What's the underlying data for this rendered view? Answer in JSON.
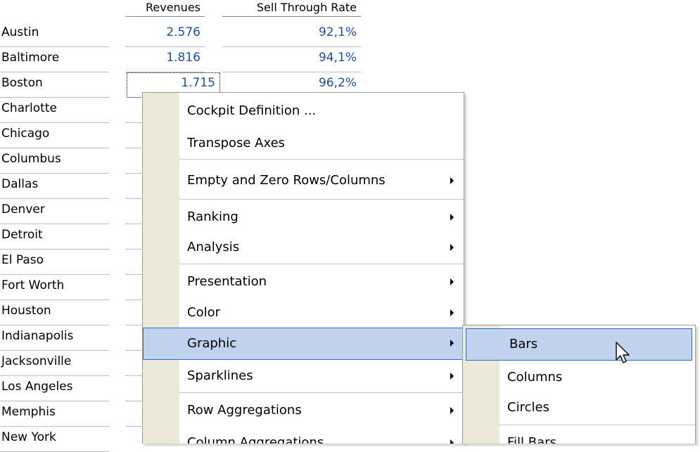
{
  "grid": {
    "headers": [
      "Revenues",
      "Sell Through Rate"
    ],
    "rows": [
      {
        "city": "Austin",
        "revenues": "2.576",
        "sell_through": "92,1%"
      },
      {
        "city": "Baltimore",
        "revenues": "1.816",
        "sell_through": "94,1%"
      },
      {
        "city": "Boston",
        "revenues": "1.715",
        "sell_through": "96,2%"
      },
      {
        "city": "Charlotte",
        "revenues": "",
        "sell_through": ""
      },
      {
        "city": "Chicago",
        "revenues": "",
        "sell_through": ""
      },
      {
        "city": "Columbus",
        "revenues": "",
        "sell_through": ""
      },
      {
        "city": "Dallas",
        "revenues": "",
        "sell_through": ""
      },
      {
        "city": "Denver",
        "revenues": "",
        "sell_through": ""
      },
      {
        "city": "Detroit",
        "revenues": "",
        "sell_through": ""
      },
      {
        "city": "El Paso",
        "revenues": "",
        "sell_through": ""
      },
      {
        "city": "Fort Worth",
        "revenues": "",
        "sell_through": ""
      },
      {
        "city": "Houston",
        "revenues": "",
        "sell_through": ""
      },
      {
        "city": "Indianapolis",
        "revenues": "",
        "sell_through": ""
      },
      {
        "city": "Jacksonville",
        "revenues": "",
        "sell_through": ""
      },
      {
        "city": "Los Angeles",
        "revenues": "",
        "sell_through": ""
      },
      {
        "city": "Memphis",
        "revenues": "",
        "sell_through": ""
      },
      {
        "city": "New York",
        "revenues": "",
        "sell_through": ""
      }
    ]
  },
  "context_menu": {
    "items": [
      {
        "label": "Cockpit Definition ...",
        "submenu": false,
        "highlighted": false
      },
      {
        "label": "Transpose Axes",
        "submenu": false,
        "highlighted": false
      },
      {
        "label": "Empty and Zero Rows/Columns",
        "submenu": true,
        "highlighted": false
      },
      {
        "label": "Ranking",
        "submenu": true,
        "highlighted": false
      },
      {
        "label": "Analysis",
        "submenu": true,
        "highlighted": false
      },
      {
        "label": "Presentation",
        "submenu": true,
        "highlighted": false
      },
      {
        "label": "Color",
        "submenu": true,
        "highlighted": false
      },
      {
        "label": "Graphic",
        "submenu": true,
        "highlighted": true
      },
      {
        "label": "Sparklines",
        "submenu": true,
        "highlighted": false
      },
      {
        "label": "Row Aggregations",
        "submenu": true,
        "highlighted": false
      },
      {
        "label": "Column Aggregations",
        "submenu": true,
        "highlighted": false
      }
    ]
  },
  "graphic_submenu": {
    "items": [
      {
        "label": "Bars",
        "highlighted": true
      },
      {
        "label": "Columns",
        "highlighted": false
      },
      {
        "label": "Circles",
        "highlighted": false
      },
      {
        "label": "Fill Bars",
        "highlighted": false
      }
    ]
  },
  "colors": {
    "value_text": "#1f4ea1",
    "highlight_bg": "#c1d2ee",
    "highlight_border": "#316ac5",
    "menu_gutter": "#ece9d8"
  },
  "icons": {
    "cursor": "arrow-pointer-icon",
    "submenu_arrow": "submenu-arrow-icon"
  }
}
